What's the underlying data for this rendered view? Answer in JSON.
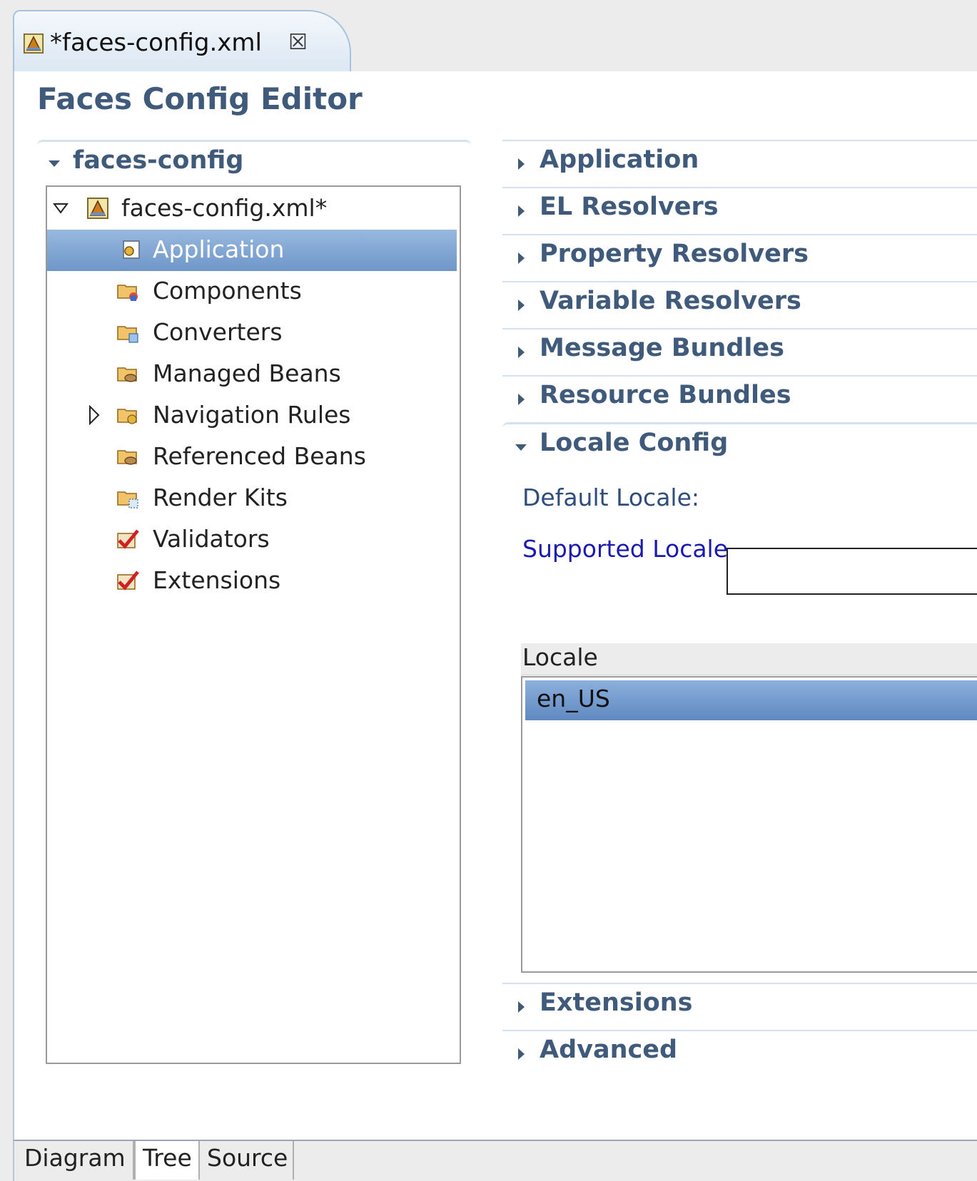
{
  "tab": {
    "title": "*faces-config.xml",
    "close_glyph": "☒"
  },
  "editor": {
    "title": "Faces Config Editor"
  },
  "tree_section": {
    "title": "faces-config",
    "root_label": "faces-config.xml*",
    "items": [
      {
        "label": "Application",
        "icon": "application-icon",
        "selected": true
      },
      {
        "label": "Components",
        "icon": "components-folder-icon"
      },
      {
        "label": "Converters",
        "icon": "converters-folder-icon"
      },
      {
        "label": "Managed Beans",
        "icon": "managed-beans-folder-icon"
      },
      {
        "label": "Navigation Rules",
        "icon": "navigation-rules-folder-icon",
        "expandable": true
      },
      {
        "label": "Referenced Beans",
        "icon": "referenced-beans-folder-icon"
      },
      {
        "label": "Render Kits",
        "icon": "render-kits-folder-icon"
      },
      {
        "label": "Validators",
        "icon": "validators-check-icon"
      },
      {
        "label": "Extensions",
        "icon": "extensions-check-icon"
      }
    ]
  },
  "sections": {
    "application": "Application",
    "el_resolvers": "EL Resolvers",
    "property_resolvers": "Property Resolvers",
    "variable_resolvers": "Variable Resolvers",
    "message_bundles": "Message Bundles",
    "resource_bundles": "Resource Bundles",
    "locale_config": "Locale Config",
    "extensions": "Extensions",
    "advanced": "Advanced"
  },
  "locale_config": {
    "default_locale_label": "Default Locale:",
    "default_locale_value": "",
    "supported_locale_label": "Supported Locale",
    "column_header": "Locale",
    "rows": [
      "en_US"
    ]
  },
  "bottom_tabs": {
    "diagram": "Diagram",
    "tree": "Tree",
    "source": "Source"
  },
  "colors": {
    "section_title": "#3f5a7a",
    "selection": "#6f96c9",
    "link_blue": "#1a1ab0"
  }
}
